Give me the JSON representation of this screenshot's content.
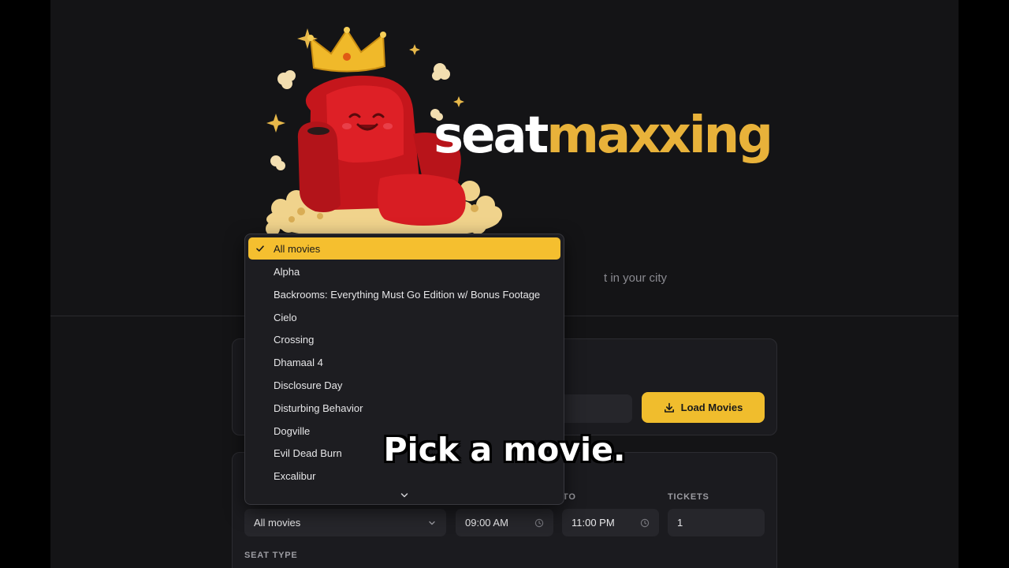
{
  "header": {
    "logo_part1": "seat",
    "logo_part2": "maxxing",
    "tagline": "t in your city"
  },
  "location": {
    "load_button_label": "Load Movies",
    "load_icon": "download-icon"
  },
  "filters": {
    "to_label": "TO",
    "tickets_label": "TICKETS",
    "movie_value": "All movies",
    "from_time": "09:00 AM",
    "to_time": "11:00 PM",
    "tickets_value": "1",
    "seat_type_label": "SEAT TYPE"
  },
  "dropdown": {
    "selected": "All movies",
    "options": [
      "All movies",
      "Alpha",
      "Backrooms: Everything Must Go Edition w/ Bonus Footage",
      "Cielo",
      "Crossing",
      "Dhamaal 4",
      "Disclosure Day",
      "Disturbing Behavior",
      "Dogville",
      "Evil Dead Burn",
      "Excalibur"
    ]
  },
  "caption": "Pick a movie.",
  "colors": {
    "accent": "#f5bf2f",
    "logo_accent": "#e8b23a",
    "background": "#141416",
    "card": "#1b1b1f"
  }
}
